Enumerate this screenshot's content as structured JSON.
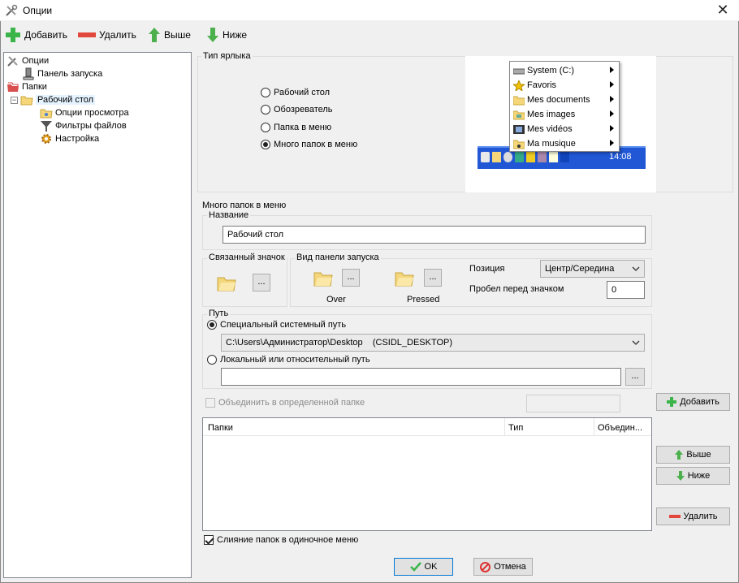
{
  "window": {
    "title": "Опции",
    "close_glyph": "✕"
  },
  "toolbar": {
    "add": "Добавить",
    "delete": "Удалить",
    "up": "Выше",
    "down": "Ниже"
  },
  "tree": {
    "items": [
      {
        "label": "Опции"
      },
      {
        "label": "Панель запуска"
      },
      {
        "label": "Папки"
      },
      {
        "label": "Рабочий стол",
        "expander": "−"
      },
      {
        "label": "Опции просмотра"
      },
      {
        "label": "Фильтры файлов"
      },
      {
        "label": "Настройка"
      }
    ]
  },
  "shortcut_type": {
    "title": "Тип ярлыка",
    "options": [
      "Рабочий стол",
      "Обозреватель",
      "Папка в меню",
      "Много папок в меню"
    ],
    "selected_index": 3
  },
  "preview": {
    "menu_items": [
      "System (C:)",
      "Favoris",
      "Mes documents",
      "Mes images",
      "Mes vidéos",
      "Ma musique"
    ],
    "clock": "14:08"
  },
  "multi": {
    "title": "Много папок в меню",
    "name_group": "Название",
    "name_value": "Рабочий стол",
    "linked_icon": "Связанный значок",
    "launch_view": "Вид панели запуска",
    "over": "Over",
    "pressed": "Pressed",
    "position_label": "Позиция",
    "position_value": "Центр/Середина",
    "spacing_label": "Пробел перед значком",
    "spacing_value": "0",
    "dots": "...",
    "path_group": "Путь",
    "special_path": "Специальный системный путь",
    "special_path_value": "C:\\Users\\Администратор\\Desktop    (CSIDL_DESKTOP)",
    "local_path": "Локальный или относительный путь",
    "local_path_value": "",
    "merge_in_folder": "Объединить в определенной папке",
    "add_button": "Добавить",
    "columns": [
      "Папки",
      "Тип",
      "Объедин..."
    ],
    "up_button": "Выше",
    "down_button": "Ниже",
    "delete_button": "Удалить",
    "merge_single": "Слияние папок в одиночное меню"
  },
  "footer": {
    "ok": "OK",
    "cancel": "Отмена"
  },
  "colors": {
    "accent": "#0078d7",
    "add_green": "#3bb54a",
    "delete_red": "#e2473b",
    "taskbar_blue": "#2157d5"
  }
}
